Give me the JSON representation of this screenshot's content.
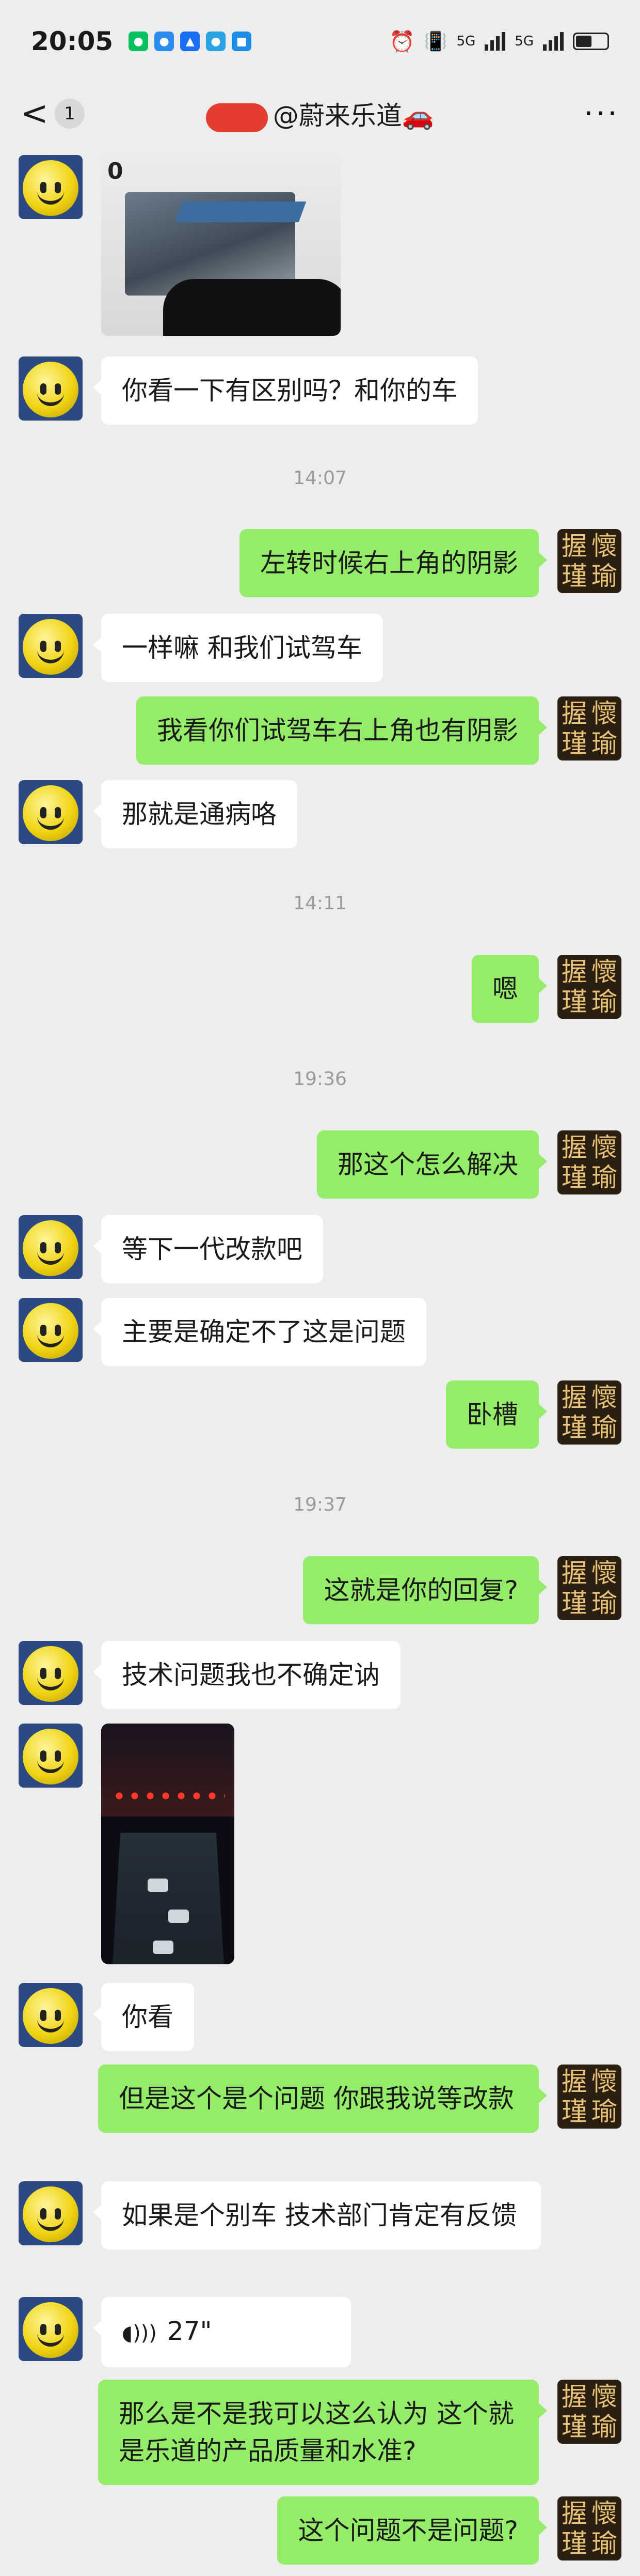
{
  "status_bar": {
    "time": "20:05",
    "network_1": "5G",
    "network_2": "5G"
  },
  "nav": {
    "back_label": "<",
    "unread_count": "1",
    "title": "@蔚来乐道🚗",
    "more_label": "···"
  },
  "avatar_mine_chars": [
    "握",
    "懷",
    "瑾",
    "瑜"
  ],
  "image1": {
    "zero": "0"
  },
  "messages": [
    {
      "text": "你看一下有区别吗？和你的车"
    },
    {
      "time": "14:07"
    },
    {
      "text": "左转时候右上角的阴影"
    },
    {
      "text": "一样嘛 和我们试驾车"
    },
    {
      "text": "我看你们试驾车右上角也有阴影"
    },
    {
      "text": "那就是通病咯"
    },
    {
      "time": "14:11"
    },
    {
      "text": "嗯"
    },
    {
      "time": "19:36"
    },
    {
      "text": "那这个怎么解决"
    },
    {
      "text": "等下一代改款吧"
    },
    {
      "text": "主要是确定不了这是问题"
    },
    {
      "text": "卧槽"
    },
    {
      "time": "19:37"
    },
    {
      "text": "这就是你的回复?"
    },
    {
      "text": "技术问题我也不确定讷"
    },
    {
      "text": "你看"
    },
    {
      "text": "但是这个是个问题 你跟我说等改款"
    },
    {
      "text": "如果是个别车 技术部门肯定有反馈"
    },
    {
      "text": "27\""
    },
    {
      "text": "那么是不是我可以这么认为 这个就是乐道的产品质量和水准?"
    },
    {
      "text": "这个问题不是问题?"
    }
  ]
}
